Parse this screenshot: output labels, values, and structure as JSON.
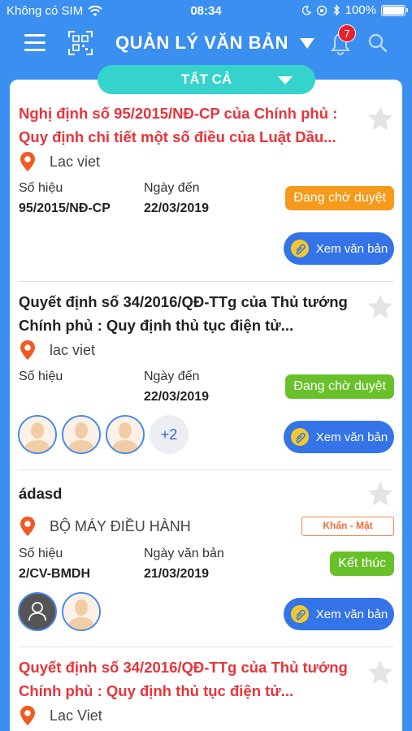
{
  "status_bar": {
    "carrier": "Không có SIM",
    "time": "08:34",
    "battery": "100%",
    "battery_level": 1.0
  },
  "header": {
    "title": "QUẢN LÝ VĂN BẢN",
    "notification_count": "7"
  },
  "filter": {
    "label": "TẤT CẢ"
  },
  "documents": [
    {
      "title": "Nghị định số 95/2015/NĐ-CP của Chính phủ : Quy định chi tiết một số điều của Luật Dầu...",
      "location": "Lac viet",
      "number_label": "Số hiệu",
      "number": "95/2015/NĐ-CP",
      "date_label": "Ngày đến",
      "date": "22/03/2019",
      "status": "Đang chờ duyệt",
      "view_label": "Xem văn bản"
    },
    {
      "title": "Quyết định số 34/2016/QĐ-TTg của Thủ tướng Chính phủ : Quy định thủ tục điện tử...",
      "location": "lac viet",
      "number_label": "Số hiệu",
      "number": "",
      "date_label": "Ngày đến",
      "date": "22/03/2019",
      "status": "Đang chờ duyệt",
      "more_count": "+2",
      "view_label": "Xem văn bản"
    },
    {
      "title": "ádasd",
      "location": "BỘ MÁY ĐIỀU HÀNH",
      "priority": "Khẩn - Mật",
      "number_label": "Số hiệu",
      "number": "2/CV-BMDH",
      "date_label": "Ngày văn bản",
      "date": "21/03/2019",
      "status": "Kết thúc",
      "view_label": "Xem văn bản"
    },
    {
      "title": "Quyết định số 34/2016/QĐ-TTg của Thủ tướng Chính phủ : Quy định thủ tục điện tử...",
      "location": "Lac Viet"
    }
  ],
  "colors": {
    "header_bg": "#3a8ff0",
    "filter_bg": "#35d3cc",
    "title_red": "#e8343a",
    "pending_orange": "#f59a1b",
    "status_green": "#68c12a",
    "button_blue": "#3574e8",
    "pin_orange": "#f15a22"
  }
}
